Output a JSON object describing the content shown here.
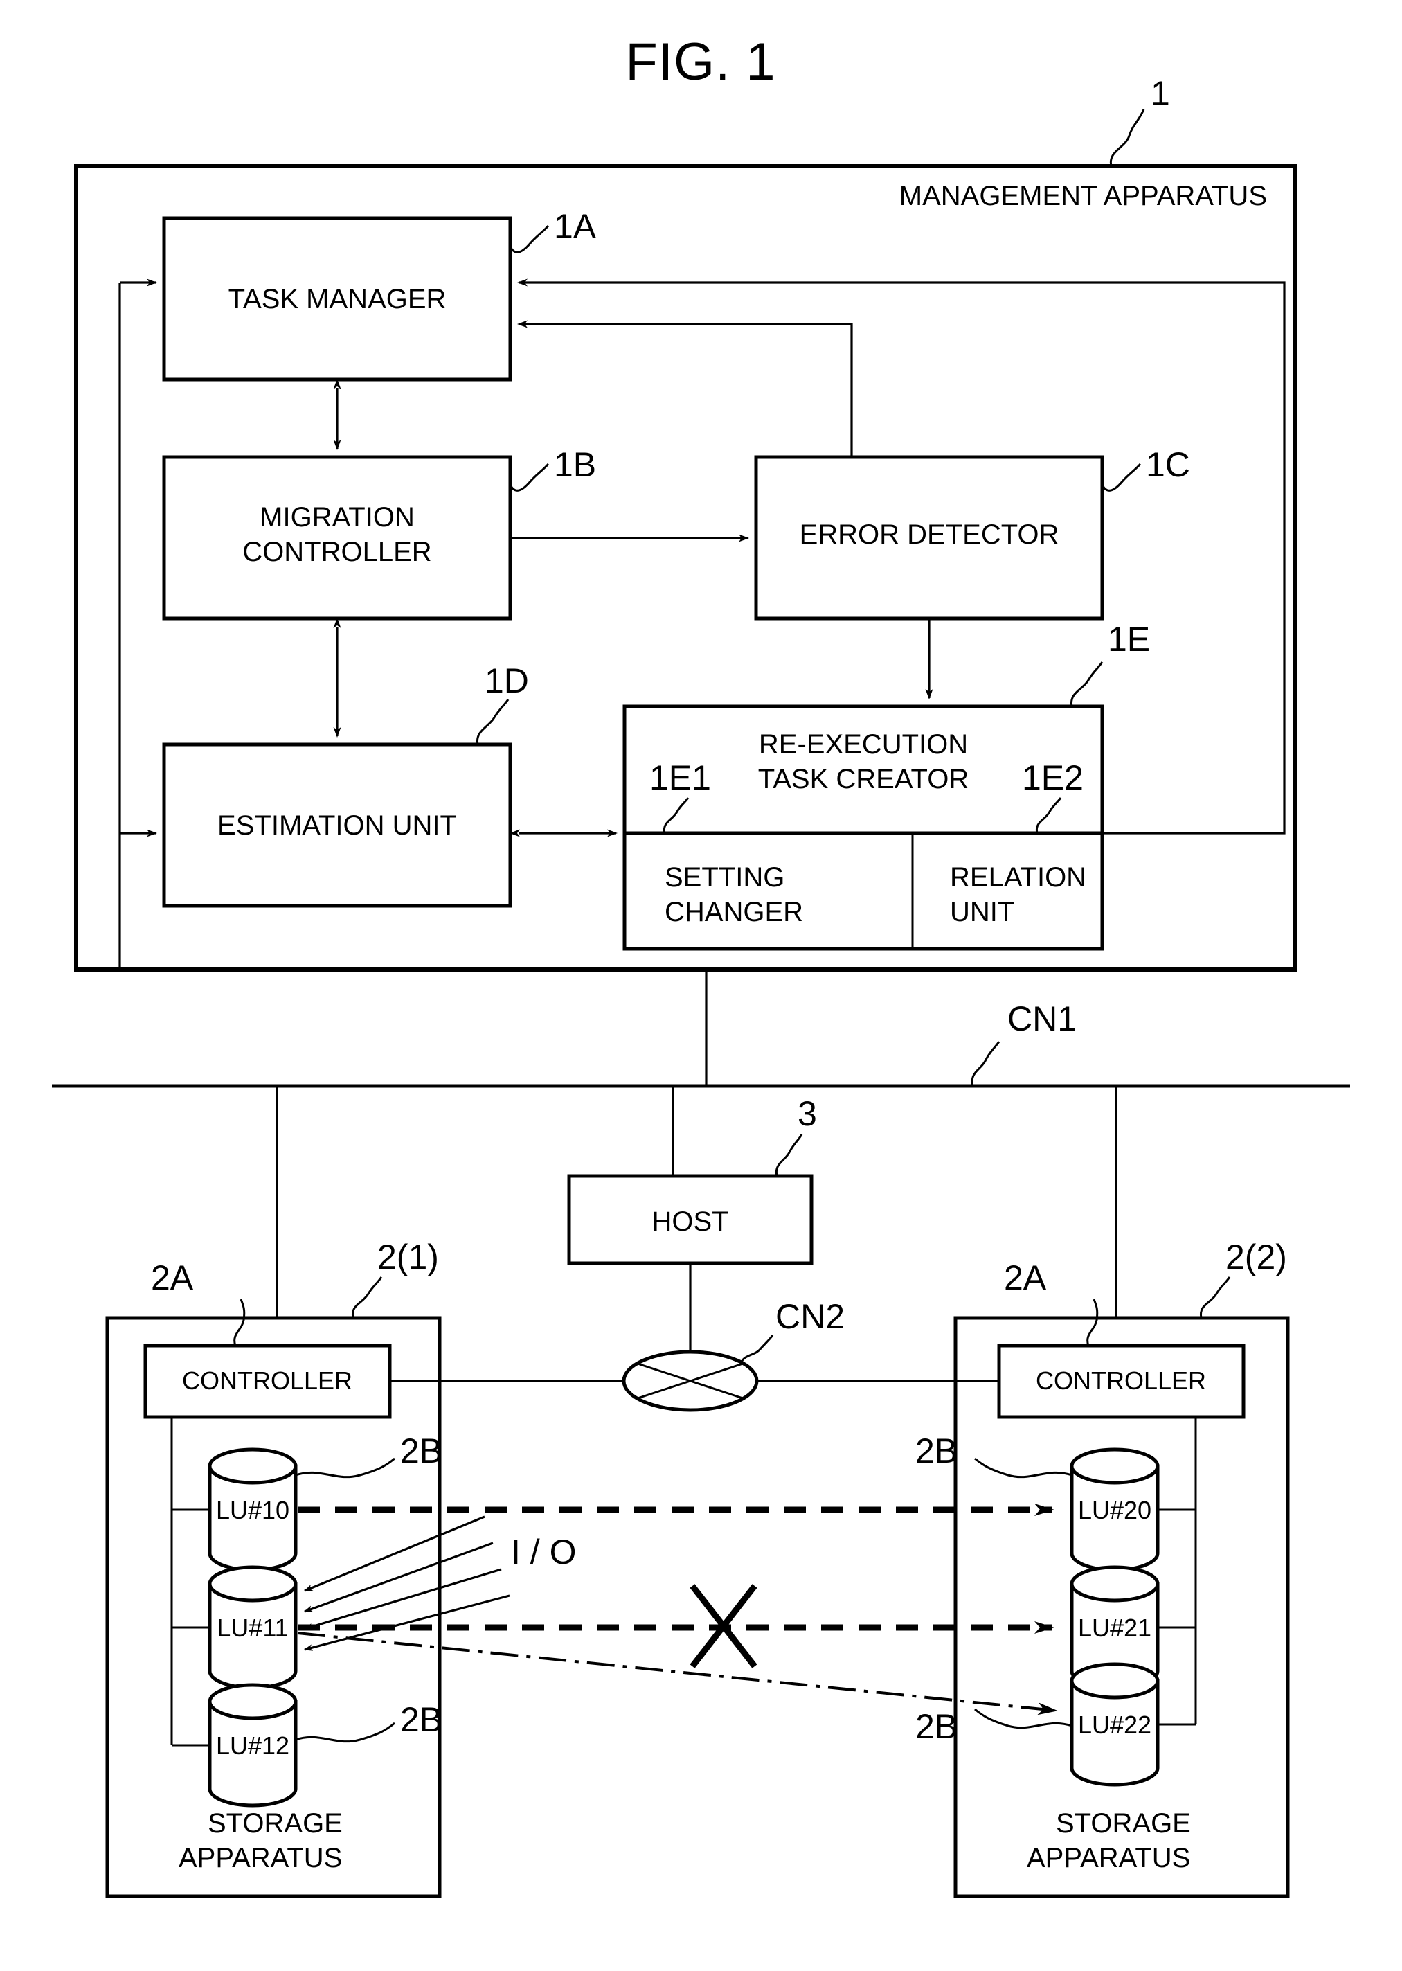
{
  "figure": {
    "title": "FIG. 1"
  },
  "management_apparatus": {
    "label": "MANAGEMENT APPARATUS",
    "ref": "1",
    "blocks": [
      {
        "id": "task_manager",
        "label": "TASK MANAGER",
        "ref": "1A"
      },
      {
        "id": "migration_controller",
        "label_line1": "MIGRATION",
        "label_line2": "CONTROLLER",
        "ref": "1B"
      },
      {
        "id": "error_detector",
        "label": "ERROR DETECTOR",
        "ref": "1C"
      },
      {
        "id": "estimation_unit",
        "label": "ESTIMATION UNIT",
        "ref": "1D"
      },
      {
        "id": "re_execution_task_creator",
        "label_line1": "RE-EXECUTION",
        "label_line2": "TASK CREATOR",
        "ref": "1E"
      },
      {
        "id": "setting_changer",
        "label_line1": "SETTING",
        "label_line2": "CHANGER",
        "ref": "1E1"
      },
      {
        "id": "relation_unit",
        "label_line1": "RELATION",
        "label_line2": "UNIT",
        "ref": "1E2"
      }
    ]
  },
  "network": {
    "cn1": "CN1",
    "cn2": "CN2"
  },
  "host": {
    "label": "HOST",
    "ref": "3"
  },
  "storage_left": {
    "apparatus_line1": "STORAGE",
    "apparatus_line2": "APPARATUS",
    "ref": "2(1)",
    "controller_label": "CONTROLLER",
    "controller_ref": "2A",
    "lu_ref_top": "2B",
    "lu_ref_bottom": "2B",
    "lus": [
      {
        "label": "LU#10"
      },
      {
        "label": "LU#11"
      },
      {
        "label": "LU#12"
      }
    ]
  },
  "storage_right": {
    "apparatus_line1": "STORAGE",
    "apparatus_line2": "APPARATUS",
    "ref": "2(2)",
    "controller_label": "CONTROLLER",
    "controller_ref": "2A",
    "lu_ref_top": "2B",
    "lu_ref_bottom": "2B",
    "lus": [
      {
        "label": "LU#20"
      },
      {
        "label": "LU#21"
      },
      {
        "label": "LU#22"
      }
    ]
  },
  "annotations": {
    "io": "I / O",
    "failure_mark": "x-cross-failure"
  },
  "colors": {
    "ink": "#000000",
    "paper": "#ffffff"
  }
}
